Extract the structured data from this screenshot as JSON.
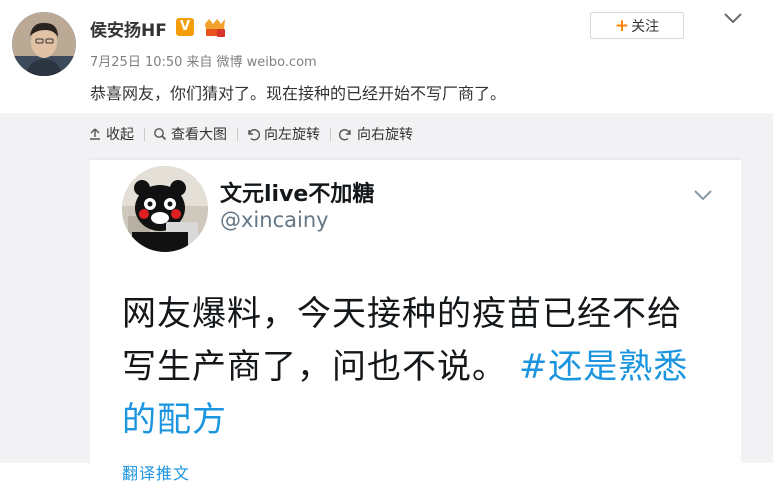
{
  "post": {
    "author": "侯安扬HF",
    "verified_badge": "V",
    "date": "7月25日 10:50",
    "source_prefix": "来自",
    "source": "微博 weibo.com",
    "text": "恭喜网友，你们猜对了。现在接种的已经开始不写厂商了。",
    "follow_label": "关注",
    "follow_icon": "+"
  },
  "toolbar": {
    "collapse": "收起",
    "view_large": "查看大图",
    "rotate_left": "向左旋转",
    "rotate_right": "向右旋转"
  },
  "tweet": {
    "name": "文元live不加糖",
    "handle": "@xincainy",
    "body_line1": "网友爆料，今天接种的疫苗已经不给",
    "body_line2_text": "写生产商了，问也不说。",
    "body_line2_tag": "#还是熟悉",
    "body_line3_tag": "的配方",
    "footer": "翻译推文"
  },
  "colors": {
    "accent_orange": "#ff8200",
    "link_blue": "#1b95e0",
    "verified_gold": "#f59e0b"
  }
}
